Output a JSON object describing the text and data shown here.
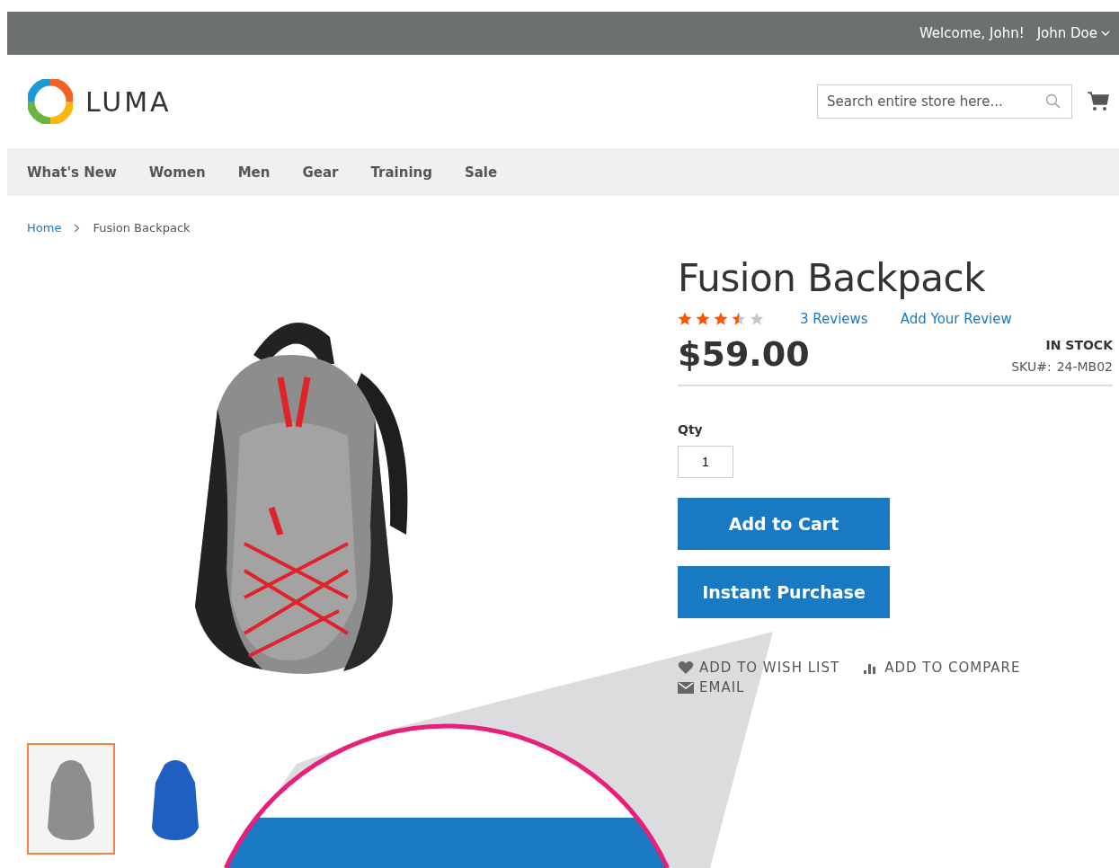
{
  "top_bar": {
    "welcome": "Welcome, John!",
    "account": "John Doe"
  },
  "header": {
    "logo_text": "LUMA",
    "search": {
      "placeholder": "Search entire store here..."
    }
  },
  "nav": [
    "What's New",
    "Women",
    "Men",
    "Gear",
    "Training",
    "Sale"
  ],
  "breadcrumb": [
    "Home",
    "Fusion Backpack"
  ],
  "gallery": {
    "thumbnails": [
      {
        "selected": true,
        "color": "#8e8e8e"
      },
      {
        "selected": false,
        "color": "#1f5fbf"
      }
    ]
  },
  "product": {
    "title": "Fusion Backpack",
    "stars": 3.5,
    "reviews": "3  Reviews",
    "add_review": "Add Your Review",
    "price": "$59.00",
    "stock": "IN STOCK",
    "sku_label": "SKU#:",
    "sku": "24-MB02",
    "qty_label": "Qty",
    "qty": "1",
    "buttons": [
      "Add to Cart",
      "Instant Purchase"
    ],
    "actions": [
      {
        "kind": "wishlist",
        "label": "ADD TO WISH LIST"
      },
      {
        "kind": "compare",
        "label": "ADD TO COMPARE"
      },
      {
        "kind": "email",
        "label": "EMAIL"
      }
    ]
  }
}
